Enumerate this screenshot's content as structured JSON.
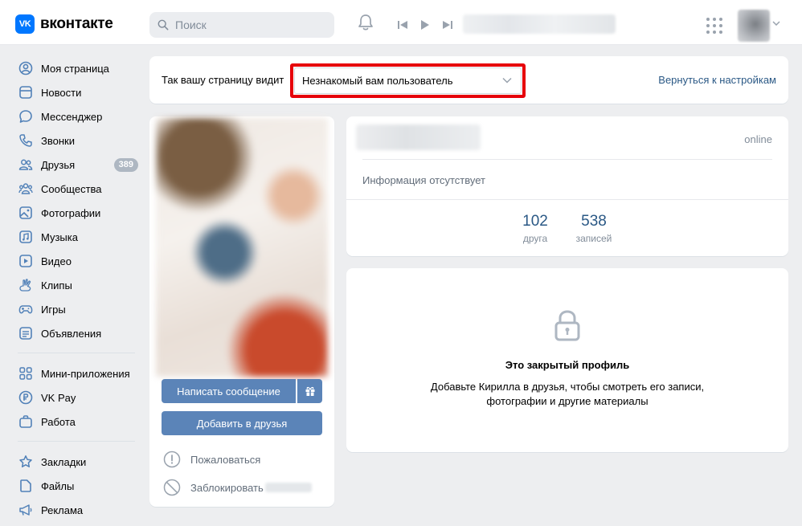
{
  "header": {
    "logo_text": "вконтакте",
    "logo_mark": "VK",
    "search_placeholder": "Поиск"
  },
  "sidebar": {
    "items": [
      {
        "label": "Моя страница",
        "icon": "user-circle-icon"
      },
      {
        "label": "Новости",
        "icon": "newspaper-icon"
      },
      {
        "label": "Мессенджер",
        "icon": "chat-icon"
      },
      {
        "label": "Звонки",
        "icon": "phone-icon"
      },
      {
        "label": "Друзья",
        "icon": "users-icon",
        "badge": "389"
      },
      {
        "label": "Сообщества",
        "icon": "community-icon"
      },
      {
        "label": "Фотографии",
        "icon": "picture-icon"
      },
      {
        "label": "Музыка",
        "icon": "music-icon"
      },
      {
        "label": "Видео",
        "icon": "video-icon"
      },
      {
        "label": "Клипы",
        "icon": "clips-icon"
      },
      {
        "label": "Игры",
        "icon": "gamepad-icon"
      },
      {
        "label": "Объявления",
        "icon": "classifieds-icon"
      }
    ],
    "items2": [
      {
        "label": "Мини-приложения",
        "icon": "apps-icon"
      },
      {
        "label": "VK Pay",
        "icon": "vkpay-icon"
      },
      {
        "label": "Работа",
        "icon": "briefcase-icon"
      }
    ],
    "items3": [
      {
        "label": "Закладки",
        "icon": "star-icon"
      },
      {
        "label": "Файлы",
        "icon": "file-icon"
      },
      {
        "label": "Реклама",
        "icon": "megaphone-icon"
      }
    ]
  },
  "banner": {
    "label": "Так вашу страницу видит",
    "select_value": "Незнакомый вам пользователь",
    "back_link": "Вернуться к настройкам"
  },
  "profile": {
    "write_message": "Написать сообщение",
    "add_friend": "Добавить в друзья",
    "report": "Пожаловаться",
    "block": "Заблокировать",
    "status": "online",
    "no_info": "Информация отсутствует",
    "counters": [
      {
        "num": "102",
        "label": "друга"
      },
      {
        "num": "538",
        "label": "записей"
      }
    ]
  },
  "closed": {
    "title": "Это закрытый профиль",
    "desc": "Добавьте Кирилла в друзья, чтобы смотреть его записи, фотографии и другие материалы"
  },
  "colors": {
    "accent": "#0077ff",
    "button": "#5b84b8",
    "link": "#2a5885",
    "highlight": "#e6000a",
    "icon": "#5181b8"
  }
}
